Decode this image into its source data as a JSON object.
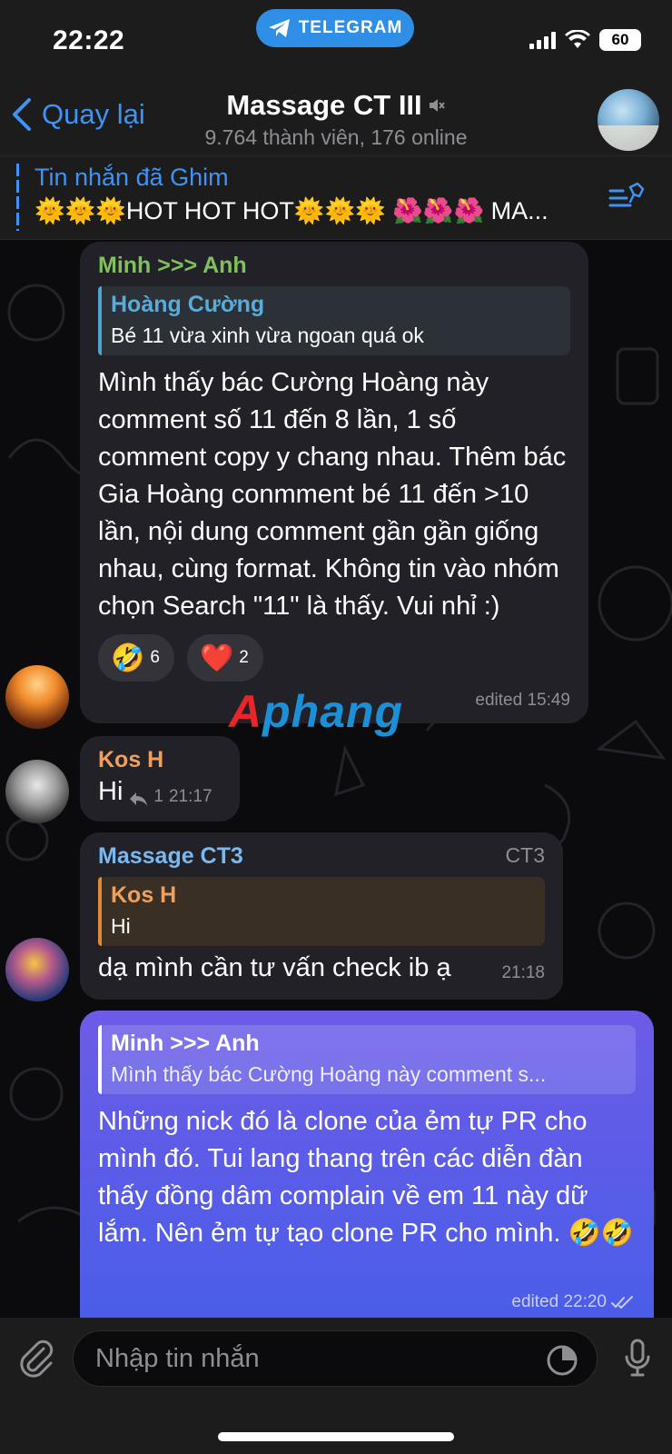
{
  "status_bar": {
    "time": "22:22",
    "app_pill": "TELEGRAM",
    "battery": "60"
  },
  "header": {
    "back_label": "Quay lại",
    "title": "Massage CT III",
    "subtitle": "9.764 thành viên, 176 online"
  },
  "pinned": {
    "title": "Tin nhắn đã Ghim",
    "text": "🌞🌞🌞HOT HOT HOT🌞🌞🌞 🌺🌺🌺 MA..."
  },
  "messages": [
    {
      "sender": "Minh >>> Anh",
      "reply_name": "Hoàng Cường",
      "reply_text": "Bé 11 vừa xinh vừa ngoan quá ok",
      "body": "Mình thấy bác Cường Hoàng này comment số 11 đến 8 lần, 1 số comment copy y chang nhau. Thêm bác Gia Hoàng conmment bé 11 đến >10 lần, nội dung comment gần gần giống nhau, cùng format. Không tin vào nhóm chọn Search \"11\" là thấy. Vui nhỉ :)",
      "reactions": [
        {
          "emoji": "🤣",
          "count": "6"
        },
        {
          "emoji": "❤️",
          "count": "2"
        }
      ],
      "time": "edited 15:49"
    },
    {
      "sender": "Kos H",
      "body": "Hi",
      "reply_count": "1",
      "time": "21:17"
    },
    {
      "sender": "Massage CT3",
      "tag": "CT3",
      "reply_name": "Kos H",
      "reply_text": "Hi",
      "body": "dạ mình cần tư vấn check ib ạ",
      "time": "21:18"
    },
    {
      "reply_name": "Minh >>> Anh",
      "reply_text": "Mình thấy bác Cường Hoàng này comment s...",
      "body": "Những nick đó là clone của ẻm tự PR cho mình đó. Tui lang thang trên các diễn đàn thấy đồng dâm complain về em 11 này dữ lắm. Nên ẻm tự tạo clone PR cho mình. 🤣🤣",
      "time": "edited 22:20"
    }
  ],
  "watermark": {
    "first": "A",
    "rest": "phang"
  },
  "input": {
    "placeholder": "Nhập tin nhắn"
  },
  "colors": {
    "accent": "#3e93f5",
    "outgoing_top": "#6c5ce7",
    "outgoing_bottom": "#4a5de8"
  }
}
